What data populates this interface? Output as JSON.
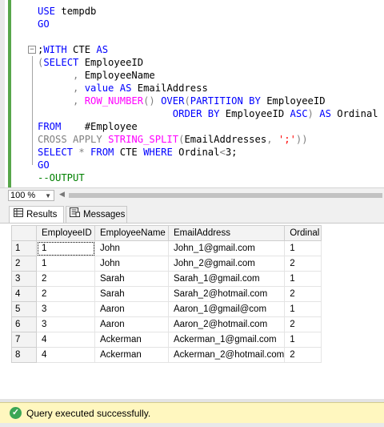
{
  "editor": {
    "lines": [
      [
        {
          "t": "USE",
          "c": "kw"
        },
        {
          "t": " tempdb",
          "c": ""
        }
      ],
      [
        {
          "t": "GO",
          "c": "kw"
        }
      ],
      [],
      [
        {
          "t": ";",
          "c": ""
        },
        {
          "t": "WITH",
          "c": "kw"
        },
        {
          "t": " CTE ",
          "c": ""
        },
        {
          "t": "AS",
          "c": "kw"
        }
      ],
      [
        {
          "t": "(",
          "c": "gy"
        },
        {
          "t": "SELECT",
          "c": "kw"
        },
        {
          "t": " EmployeeID",
          "c": ""
        }
      ],
      [
        {
          "t": "      , ",
          "c": "gy"
        },
        {
          "t": "EmployeeName",
          "c": ""
        }
      ],
      [
        {
          "t": "      , ",
          "c": "gy"
        },
        {
          "t": "value",
          "c": "kw"
        },
        {
          "t": " ",
          "c": ""
        },
        {
          "t": "AS",
          "c": "kw"
        },
        {
          "t": " EmailAddress",
          "c": ""
        }
      ],
      [
        {
          "t": "      , ",
          "c": "gy"
        },
        {
          "t": "ROW_NUMBER",
          "c": "fn"
        },
        {
          "t": "() ",
          "c": "gy"
        },
        {
          "t": "OVER",
          "c": "kw"
        },
        {
          "t": "(",
          "c": "gy"
        },
        {
          "t": "PARTITION BY",
          "c": "kw"
        },
        {
          "t": " EmployeeID",
          "c": ""
        }
      ],
      [
        {
          "t": "                       ",
          "c": ""
        },
        {
          "t": "ORDER BY",
          "c": "kw"
        },
        {
          "t": " EmployeeID ",
          "c": ""
        },
        {
          "t": "ASC",
          "c": "kw"
        },
        {
          "t": ") ",
          "c": "gy"
        },
        {
          "t": "AS",
          "c": "kw"
        },
        {
          "t": " Ordinal",
          "c": ""
        }
      ],
      [
        {
          "t": "FROM",
          "c": "kw"
        },
        {
          "t": "    #Employee",
          "c": ""
        }
      ],
      [
        {
          "t": "CROSS APPLY",
          "c": "gy"
        },
        {
          "t": " ",
          "c": ""
        },
        {
          "t": "STRING_SPLIT",
          "c": "fn"
        },
        {
          "t": "(",
          "c": "gy"
        },
        {
          "t": "EmailAddresses",
          "c": ""
        },
        {
          "t": ", ",
          "c": "gy"
        },
        {
          "t": "';'",
          "c": "str"
        },
        {
          "t": "))",
          "c": "gy"
        }
      ],
      [
        {
          "t": "SELECT",
          "c": "kw"
        },
        {
          "t": " * ",
          "c": "gy"
        },
        {
          "t": "FROM",
          "c": "kw"
        },
        {
          "t": " CTE ",
          "c": ""
        },
        {
          "t": "WHERE",
          "c": "kw"
        },
        {
          "t": " Ordinal",
          "c": ""
        },
        {
          "t": "<",
          "c": "gy"
        },
        {
          "t": "3;",
          "c": ""
        }
      ],
      [
        {
          "t": "GO",
          "c": "kw"
        }
      ],
      [
        {
          "t": "--OUTPUT",
          "c": "cm"
        }
      ]
    ]
  },
  "zoom": {
    "value": "100 %"
  },
  "tabs": {
    "results_label": "Results",
    "messages_label": "Messages"
  },
  "grid": {
    "columns": [
      "EmployeeID",
      "EmployeeName",
      "EmailAddress",
      "Ordinal"
    ],
    "rows": [
      [
        "1",
        "1",
        "John",
        "John_1@gmail.com",
        "1"
      ],
      [
        "2",
        "1",
        "John",
        "John_2@gmail.com",
        "2"
      ],
      [
        "3",
        "2",
        "Sarah",
        "Sarah_1@gmail.com",
        "1"
      ],
      [
        "4",
        "2",
        "Sarah",
        "Sarah_2@hotmail.com",
        "2"
      ],
      [
        "5",
        "3",
        "Aaron",
        "Aaron_1@gmail@com",
        "1"
      ],
      [
        "6",
        "3",
        "Aaron",
        "Aaron_2@hotmail.com",
        "2"
      ],
      [
        "7",
        "4",
        "Ackerman",
        "Ackerman_1@gmail.com",
        "1"
      ],
      [
        "8",
        "4",
        "Ackerman",
        "Ackerman_2@hotmail.com",
        "2"
      ]
    ]
  },
  "status": {
    "message": "Query executed successfully."
  }
}
